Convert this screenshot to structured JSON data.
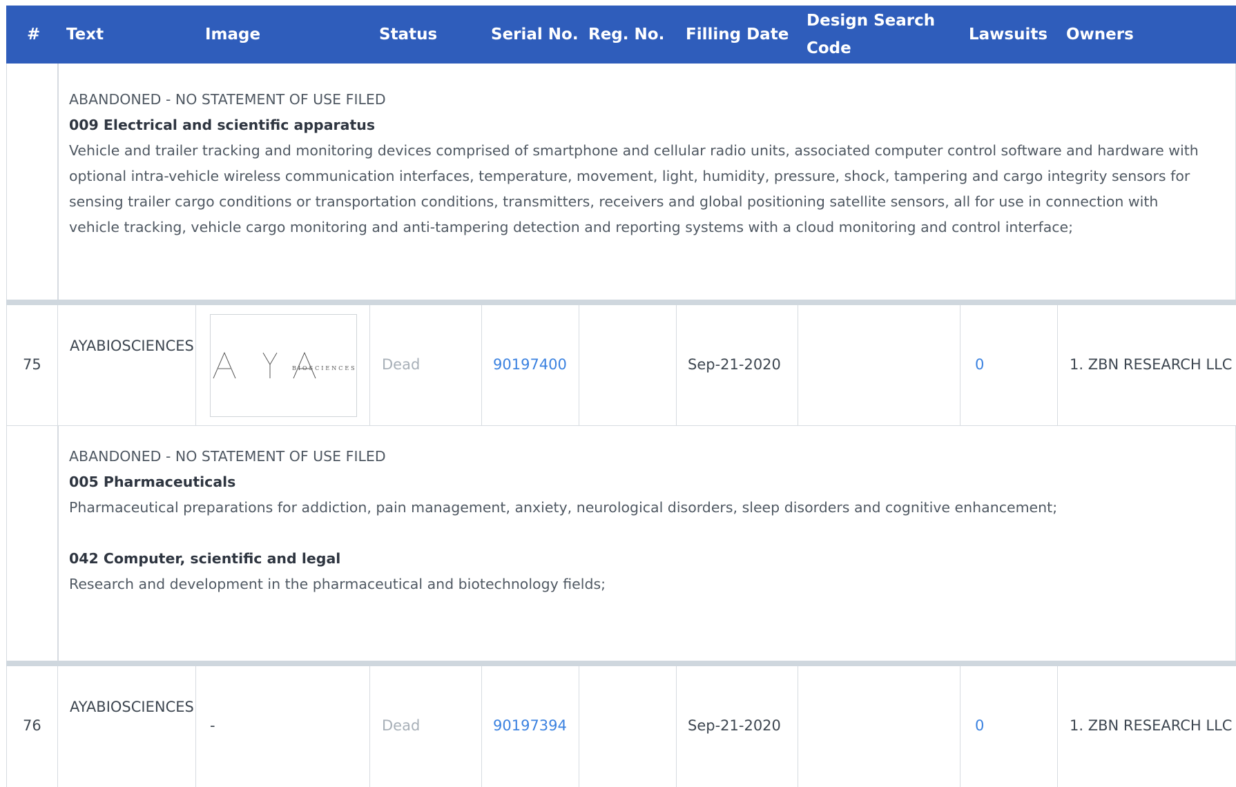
{
  "header": {
    "num": "#",
    "text": "Text",
    "image": "Image",
    "status": "Status",
    "serial": "Serial No.",
    "reg": "Reg. No.",
    "filing_date": "Filling Date",
    "design_code_1": "Design Search",
    "design_code_2": "Code",
    "lawsuits": "Lawsuits",
    "owners": "Owners"
  },
  "detail_top": {
    "status_text": "ABANDONED - NO STATEMENT OF USE FILED",
    "classes": [
      {
        "title": "009 Electrical and scientific apparatus",
        "desc": "Vehicle and trailer tracking and monitoring devices comprised of smartphone and cellular radio units, associated computer control software and hardware with optional intra-vehicle wireless communication interfaces, temperature, movement, light, humidity, pressure, shock, tampering and cargo integrity sensors for sensing trailer cargo conditions or transportation conditions, transmitters, receivers and global positioning satellite sensors, all for use in connection with vehicle tracking, vehicle cargo monitoring and anti-tampering detection and reporting systems with a cloud monitoring and control interface;"
      }
    ]
  },
  "rows": [
    {
      "num": "75",
      "text": "AYABIOSCIENCES",
      "image_logo": {
        "letters": "A Y A",
        "sub": "BIOSCIENCES"
      },
      "image_dash": "",
      "status": "Dead",
      "serial": "90197400",
      "reg": "",
      "filing_date": "Sep-21-2020",
      "design_code": "",
      "lawsuits": "0",
      "owners": "1. ZBN RESEARCH LLC",
      "detail": {
        "status_text": "ABANDONED - NO STATEMENT OF USE FILED",
        "classes": [
          {
            "title": "005 Pharmaceuticals",
            "desc": "Pharmaceutical preparations for addiction, pain management, anxiety, neurological disorders, sleep disorders and cognitive enhancement;"
          },
          {
            "title": "042 Computer, scientific and legal",
            "desc": "Research and development in the pharmaceutical and biotechnology fields;"
          }
        ]
      }
    },
    {
      "num": "76",
      "text": "AYABIOSCIENCES",
      "image_dash": "-",
      "status": "Dead",
      "serial": "90197394",
      "reg": "",
      "filing_date": "Sep-21-2020",
      "design_code": "",
      "lawsuits": "0",
      "owners": "1. ZBN RESEARCH LLC"
    }
  ],
  "colors": {
    "header_bg": "#2f5dbb",
    "link": "#3b82e0",
    "dead": "#a8b0b8"
  }
}
